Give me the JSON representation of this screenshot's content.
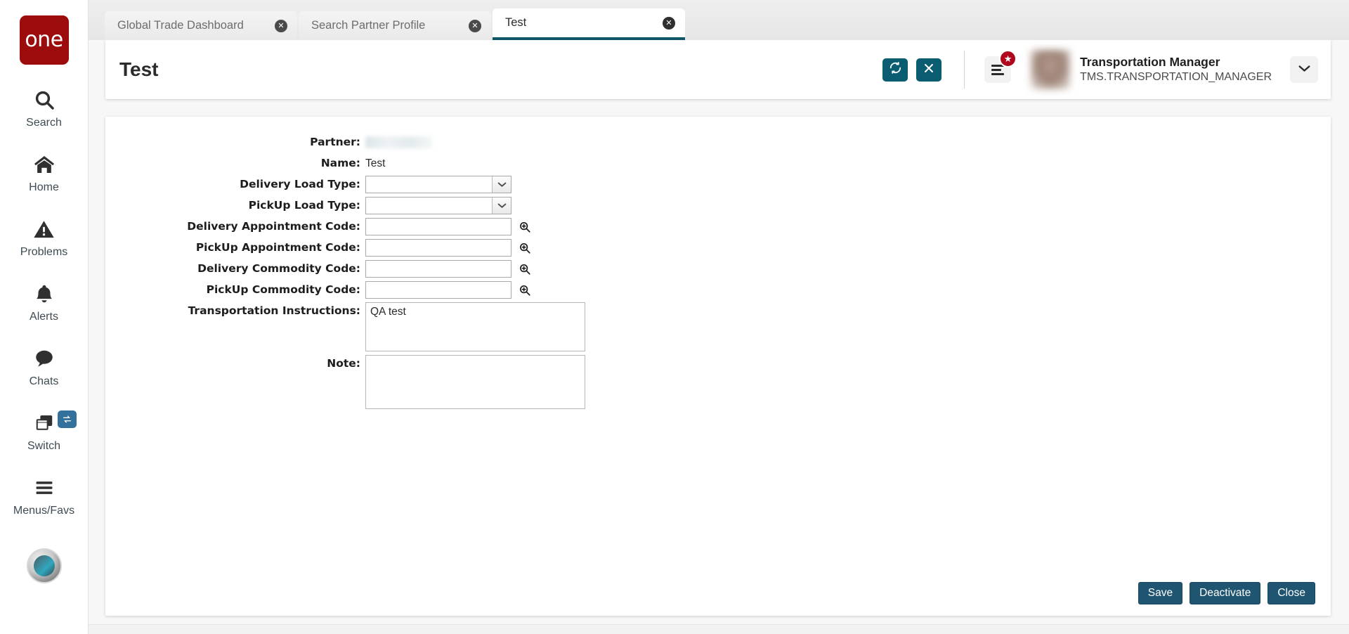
{
  "sidebar": {
    "logo_text": "one",
    "items": [
      {
        "label": "Search",
        "icon": "search-icon"
      },
      {
        "label": "Home",
        "icon": "home-icon"
      },
      {
        "label": "Problems",
        "icon": "warning-triangle-icon"
      },
      {
        "label": "Alerts",
        "icon": "bell-icon"
      },
      {
        "label": "Chats",
        "icon": "chat-bubble-icon"
      },
      {
        "label": "Switch",
        "icon": "switch-windows-icon",
        "badge_icon": "swap-arrows-icon"
      },
      {
        "label": "Menus/Favs",
        "icon": "hamburger-icon"
      }
    ]
  },
  "tabs": [
    {
      "label": "Global Trade Dashboard",
      "active": false,
      "close_glyph": "✕"
    },
    {
      "label": "Search Partner Profile",
      "active": false,
      "close_glyph": "✕"
    },
    {
      "label": "Test",
      "active": true,
      "close_glyph": "✕"
    }
  ],
  "header": {
    "title": "Test",
    "refresh_glyph": "↻",
    "close_glyph": "✕",
    "star_glyph": "★",
    "caret_glyph": "⌄",
    "user_name": "Transportation Manager",
    "user_role": "TMS.TRANSPORTATION_MANAGER"
  },
  "form": {
    "fields": [
      {
        "label": "Partner:",
        "type": "blurred-value",
        "value": ""
      },
      {
        "label": "Name:",
        "type": "text-value",
        "value": "Test"
      },
      {
        "label": "Delivery Load Type:",
        "type": "select",
        "value": "",
        "arrow_glyph": "⌄"
      },
      {
        "label": "PickUp Load Type:",
        "type": "select",
        "value": "",
        "arrow_glyph": "⌄"
      },
      {
        "label": "Delivery Appointment Code:",
        "type": "lookup",
        "value": "",
        "placeholder": ""
      },
      {
        "label": "PickUp Appointment Code:",
        "type": "lookup",
        "value": "",
        "placeholder": ""
      },
      {
        "label": "Delivery Commodity Code:",
        "type": "lookup",
        "value": "",
        "placeholder": ""
      },
      {
        "label": "PickUp Commodity Code:",
        "type": "lookup",
        "value": "",
        "placeholder": ""
      },
      {
        "label": "Transportation Instructions:",
        "type": "textarea",
        "value": "QA test",
        "placeholder": ""
      },
      {
        "label": "Note:",
        "type": "textarea-note",
        "value": "",
        "placeholder": ""
      }
    ]
  },
  "footer": {
    "save_label": "Save",
    "deactivate_label": "Deactivate",
    "close_label": "Close"
  },
  "colors": {
    "brand_red": "#9c0c0c",
    "accent_teal": "#0a5c70",
    "button_blue": "#1f5570",
    "active_tab_underline": "#10566b",
    "badge_red": "#b1071c",
    "switch_badge_blue": "#33719c"
  }
}
